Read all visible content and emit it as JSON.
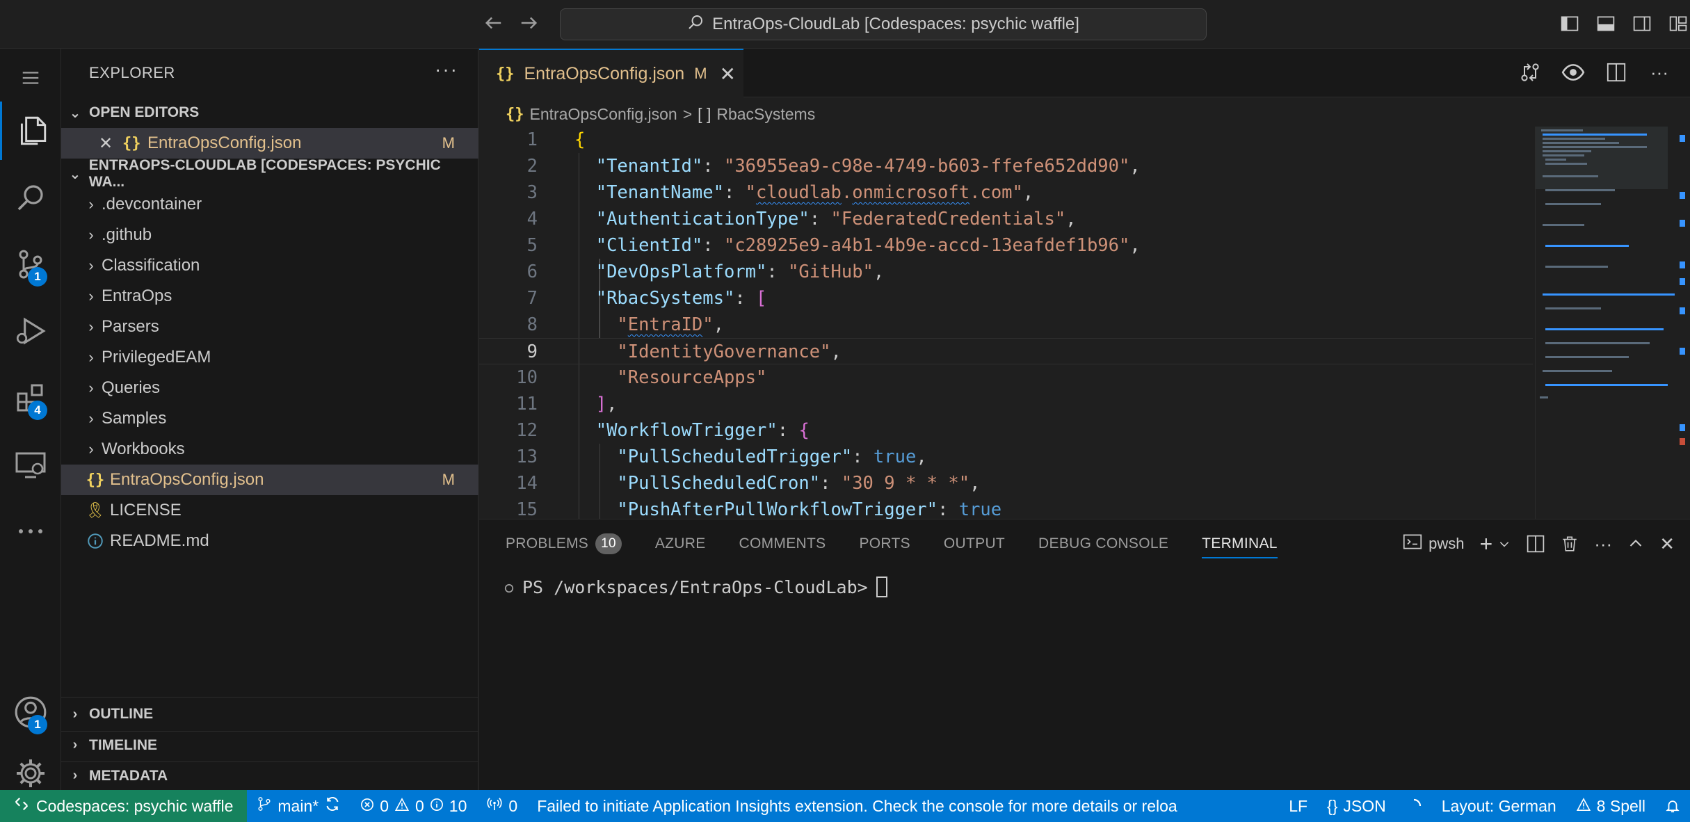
{
  "titlebar": {
    "back_icon": "arrow-left-icon",
    "forward_icon": "arrow-right-icon",
    "search_text": "EntraOps-CloudLab [Codespaces: psychic waffle]",
    "layout_icons": [
      "toggle-primary-sidebar-icon",
      "toggle-panel-icon",
      "toggle-secondary-sidebar-icon",
      "customize-layout-icon"
    ]
  },
  "activitybar": {
    "items": [
      {
        "name": "menu",
        "icon": "hamburger-icon"
      },
      {
        "name": "explorer",
        "icon": "files-icon",
        "active": true
      },
      {
        "name": "search",
        "icon": "search-icon"
      },
      {
        "name": "source-control",
        "icon": "source-control-icon",
        "badge": "1"
      },
      {
        "name": "run-debug",
        "icon": "run-debug-icon"
      },
      {
        "name": "extensions",
        "icon": "extensions-icon",
        "badge": "4"
      },
      {
        "name": "remote-explorer",
        "icon": "remote-explorer-icon"
      },
      {
        "name": "more",
        "icon": "ellipsis-icon"
      },
      {
        "name": "accounts",
        "icon": "account-icon",
        "badge": "1"
      },
      {
        "name": "manage",
        "icon": "gear-icon"
      }
    ]
  },
  "explorer": {
    "title": "EXPLORER",
    "open_editors": {
      "header": "OPEN EDITORS",
      "file": "EntraOpsConfig.json",
      "status": "M"
    },
    "workspace": {
      "header": "ENTRAOPS-CLOUDLAB [CODESPACES: PSYCHIC WA...",
      "folders": [
        ".devcontainer",
        ".github",
        "Classification",
        "EntraOps",
        "Parsers",
        "PrivilegedEAM",
        "Queries",
        "Samples",
        "Workbooks"
      ],
      "files": [
        {
          "name": "EntraOpsConfig.json",
          "icon": "json-file-icon",
          "status": "M",
          "selected": true
        },
        {
          "name": "LICENSE",
          "icon": "license-icon"
        },
        {
          "name": "README.md",
          "icon": "info-icon"
        }
      ]
    },
    "bottom_sections": [
      "OUTLINE",
      "TIMELINE",
      "METADATA"
    ]
  },
  "editor": {
    "tab": {
      "label": "EntraOpsConfig.json",
      "status": "M",
      "close": "close-icon"
    },
    "actions": [
      "compare-changes-icon",
      "preview-eye-icon",
      "split-editor-icon",
      "more-actions-icon"
    ],
    "breadcrumb": {
      "file": "EntraOpsConfig.json",
      "separator": ">",
      "symbol_icon": "[ ]",
      "symbol": "RbacSystems"
    },
    "current_line": 9,
    "lines": [
      {
        "n": "1"
      },
      {
        "n": "2"
      },
      {
        "n": "3"
      },
      {
        "n": "4"
      },
      {
        "n": "5"
      },
      {
        "n": "6"
      },
      {
        "n": "7"
      },
      {
        "n": "8"
      },
      {
        "n": "9"
      },
      {
        "n": "10"
      },
      {
        "n": "11"
      },
      {
        "n": "12"
      },
      {
        "n": "13"
      },
      {
        "n": "14"
      },
      {
        "n": "15"
      }
    ],
    "code": {
      "tenant_id_key": "\"TenantId\"",
      "tenant_id_val": "\"36955ea9-c98e-4749-b603-ffefe652dd90\"",
      "tenant_name_key": "\"TenantName\"",
      "tenant_name_q1": "\"",
      "tenant_name_p1": "cloudlab",
      "tenant_name_dot1": ".",
      "tenant_name_p2": "onmicrosoft",
      "tenant_name_rest": ".com\"",
      "auth_key": "\"AuthenticationType\"",
      "auth_val": "\"FederatedCredentials\"",
      "client_key": "\"ClientId\"",
      "client_val": "\"c28925e9-a4b1-4b9e-accd-13eafdef1b96\"",
      "devops_key": "\"DevOpsPlatform\"",
      "devops_val": "\"GitHub\"",
      "rbac_key": "\"RbacSystems\"",
      "rbac_1_q": "\"",
      "rbac_1_word": "EntraID",
      "rbac_1_end": "\"",
      "rbac_2": "\"IdentityGovernance\"",
      "rbac_3": "\"ResourceApps\"",
      "workflow_key": "\"WorkflowTrigger\"",
      "pull_sched_key": "\"PullScheduledTrigger\"",
      "pull_sched_val": "true",
      "pull_cron_key": "\"PullScheduledCron\"",
      "pull_cron_val": "\"30 9 * * *\"",
      "push_key": "\"PushAfterPullWorkflowTrigger\"",
      "push_val": "true"
    }
  },
  "panel": {
    "tabs": [
      {
        "label": "PROBLEMS",
        "count": "10"
      },
      {
        "label": "AZURE"
      },
      {
        "label": "COMMENTS"
      },
      {
        "label": "PORTS"
      },
      {
        "label": "OUTPUT"
      },
      {
        "label": "DEBUG CONSOLE"
      },
      {
        "label": "TERMINAL",
        "active": true
      }
    ],
    "terminal_profile": "pwsh",
    "actions": [
      "terminal-icon",
      "new-terminal-icon",
      "chevron-down-icon",
      "split-terminal-icon",
      "trash-icon",
      "ellipsis-icon",
      "maximize-panel-icon",
      "close-icon"
    ],
    "prompt": "PS /workspaces/EntraOps-CloudLab>"
  },
  "statusbar": {
    "remote": "Codespaces: psychic waffle",
    "branch": "main*",
    "errors": "0",
    "warnings": "0",
    "infos": "10",
    "ports": "0",
    "message": "Failed to initiate Application Insights extension. Check the console for more details or reloa",
    "eol": "LF",
    "language": "JSON",
    "layout": "Layout: German",
    "spell": "8 Spell",
    "colors": {
      "bar": "#0078d4",
      "remote": "#16825d"
    }
  }
}
